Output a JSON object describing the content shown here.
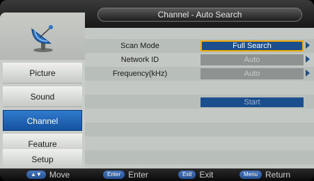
{
  "title": "Channel - Auto Search",
  "sidebar": {
    "icon": "satellite-dish-icon",
    "items": [
      {
        "label": "Picture",
        "active": false
      },
      {
        "label": "Sound",
        "active": false
      },
      {
        "label": "Channel",
        "active": true
      },
      {
        "label": "Feature",
        "active": false
      },
      {
        "label": "Setup",
        "active": false
      }
    ]
  },
  "settings": [
    {
      "label": "Scan Mode",
      "value": "Full Search",
      "state": "selected"
    },
    {
      "label": "Network ID",
      "value": "Auto",
      "state": "disabled"
    },
    {
      "label": "Frequency(kHz)",
      "value": "Auto",
      "state": "disabled"
    }
  ],
  "start_label": "Start",
  "hints": [
    {
      "key": "▲▼",
      "label": "Move"
    },
    {
      "key": "Enter",
      "label": "Enter"
    },
    {
      "key": "Exit",
      "label": "Exit"
    },
    {
      "key": "Menu",
      "label": "Return"
    }
  ],
  "colors": {
    "accent": "#1b4e8c",
    "selection_border": "#f1a800",
    "active_tab": "#2f7bcc"
  }
}
